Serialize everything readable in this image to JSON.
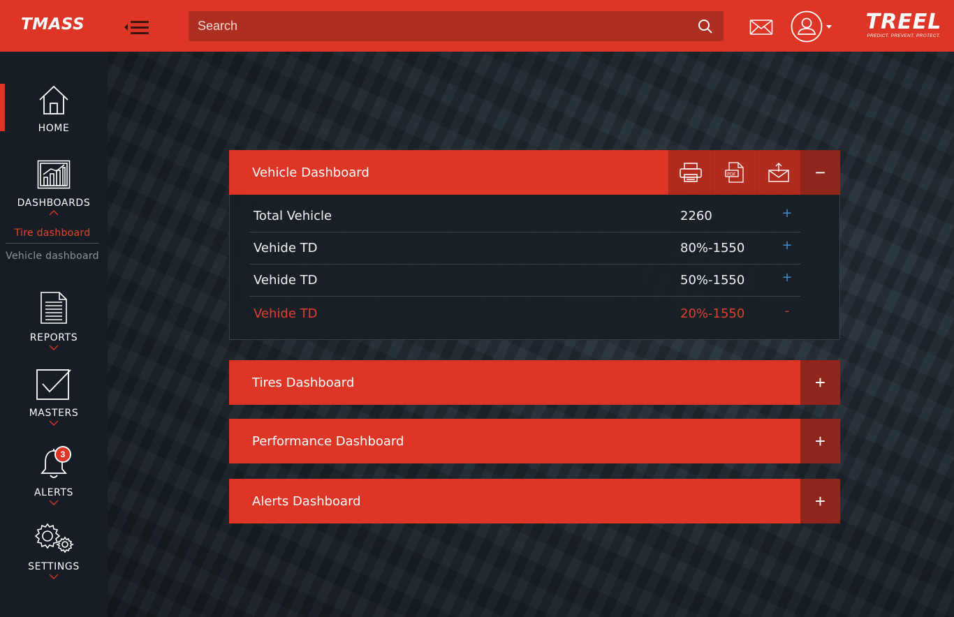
{
  "header": {
    "brand": "TMASS",
    "search_placeholder": "Search",
    "logo_word": "TREEL",
    "logo_tagline": "PREDICT. PREVENT. PROTECT."
  },
  "sidebar": {
    "items": [
      {
        "label": "HOME",
        "icon": "home-icon"
      },
      {
        "label": "DASHBOARDS",
        "icon": "dashboard-chart-icon"
      },
      {
        "label": "REPORTS",
        "icon": "document-icon"
      },
      {
        "label": "MASTERS",
        "icon": "checkbox-icon"
      },
      {
        "label": "ALERTS",
        "icon": "bell-icon",
        "badge": "3"
      },
      {
        "label": "SETTINGS",
        "icon": "gears-icon"
      }
    ],
    "dashboard_subitems": [
      "Tire dashboard",
      "Vehicle dashboard"
    ]
  },
  "panels": {
    "vehicle": {
      "title": "Vehicle Dashboard",
      "toggle": "−",
      "rows": [
        {
          "label": "Total Vehicle",
          "value": "2260",
          "action": "+"
        },
        {
          "label": "Vehide TD",
          "value": "80%-1550",
          "action": "+"
        },
        {
          "label": "Vehide TD",
          "value": "50%-1550",
          "action": "+"
        },
        {
          "label": "Vehide TD",
          "value": "20%-1550",
          "action": "-"
        }
      ]
    },
    "tires": {
      "title": "Tires Dashboard",
      "toggle": "+"
    },
    "performance": {
      "title": "Performance Dashboard",
      "toggle": "+"
    },
    "alerts": {
      "title": "Alerts Dashboard",
      "toggle": "+"
    }
  },
  "colors": {
    "accent": "#dd3526",
    "accent_dark": "#8f251b",
    "sidebar_bg": "#161d24",
    "link_blue": "#3d8fd6"
  }
}
